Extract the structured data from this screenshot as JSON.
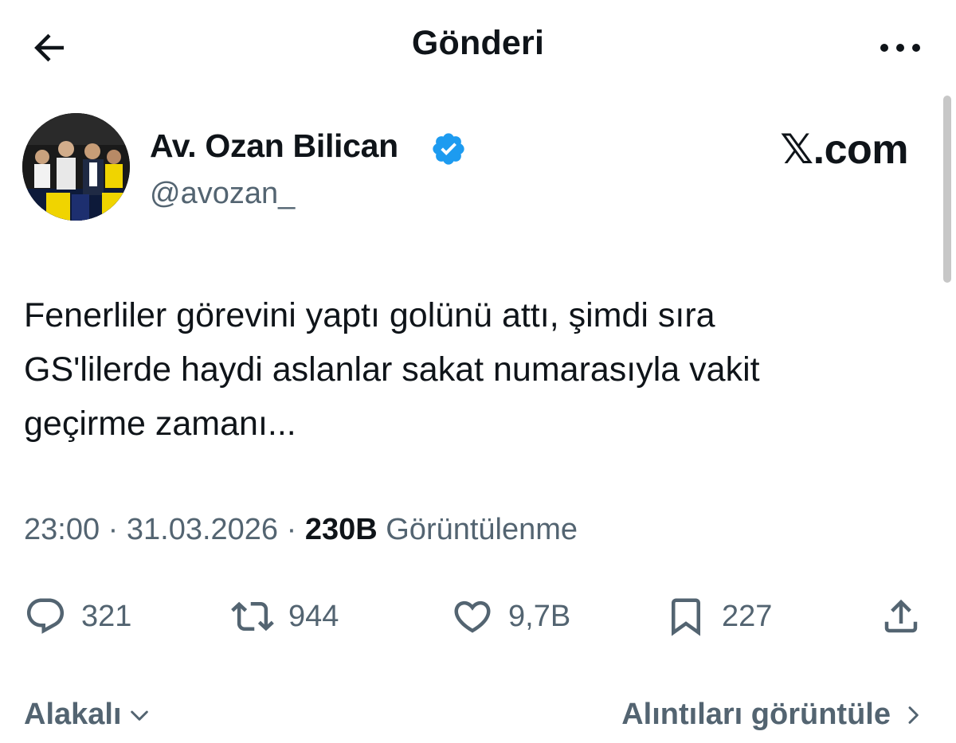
{
  "header": {
    "title": "Gönderi",
    "back_icon": "arrow-left-icon",
    "more_icon": "more-horizontal-icon"
  },
  "author": {
    "display_name": "Av. Ozan Bilican",
    "handle": "@avozan_",
    "verified_color": "#1d9bf0"
  },
  "brand": {
    "label": "𝕏.com"
  },
  "tweet": {
    "lines": [
      "Fenerliler görevini yaptı golünü attı, şimdi sıra",
      "GS'lilerde haydi aslanlar sakat numarasıyla vakit",
      "geçirme zamanı..."
    ]
  },
  "meta": {
    "time": "23:00",
    "separator": " · ",
    "date": "31.03.2026",
    "views": "230B",
    "views_label": "Görüntülenme"
  },
  "actions": {
    "replies": "321",
    "reposts": "944",
    "likes": "9,7B",
    "bookmarks": "227"
  },
  "footer": {
    "relevant": "Alakalı",
    "view_quotes": "Alıntıları görüntüle"
  },
  "colors": {
    "text": "#0f1419",
    "secondary": "#536471",
    "accent": "#1d9bf0"
  }
}
